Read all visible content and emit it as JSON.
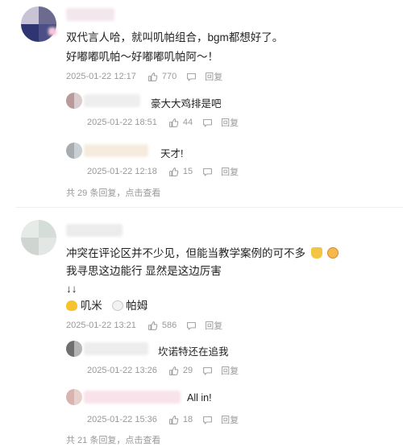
{
  "threads": [
    {
      "comment": {
        "line1": "双代言人哈，就叫叽帕组合，bgm都想好了。",
        "line2": "好嘟嘟叽帕～好嘟嘟叽帕阿～！",
        "date": "2025-01-22 12:17",
        "likes": "770",
        "reply_label": "回复"
      },
      "replies": [
        {
          "text": "豪大大鸡排是吧",
          "date": "2025-01-22 18:51",
          "likes": "44",
          "reply_label": "回复"
        },
        {
          "text": "天才!",
          "date": "2025-01-22 12:18",
          "likes": "15",
          "reply_label": "回复"
        }
      ],
      "more": "共 29 条回复，点击查看"
    },
    {
      "comment": {
        "line1": "冲突在评论区并不少见，但能当教学案例的可不多",
        "line2": "我寻思这边能行 显然是这边厉害",
        "line3": "↓↓",
        "tag1": "叽米",
        "tag2": "帕姆",
        "date": "2025-01-22 13:21",
        "likes": "586",
        "reply_label": "回复"
      },
      "replies": [
        {
          "text": "坎诺特还在追我",
          "date": "2025-01-22 13:26",
          "likes": "29",
          "reply_label": "回复"
        },
        {
          "text": "All in!",
          "date": "2025-01-22 15:36",
          "likes": "18",
          "reply_label": "回复"
        }
      ],
      "more": "共 21 条回复，点击查看"
    }
  ],
  "icons": {
    "like": "thumbs-up-icon",
    "comment": "comment-icon"
  },
  "colors": {
    "meta_text": "#999999",
    "body_text": "#222222",
    "divider": "#eeeeee"
  }
}
